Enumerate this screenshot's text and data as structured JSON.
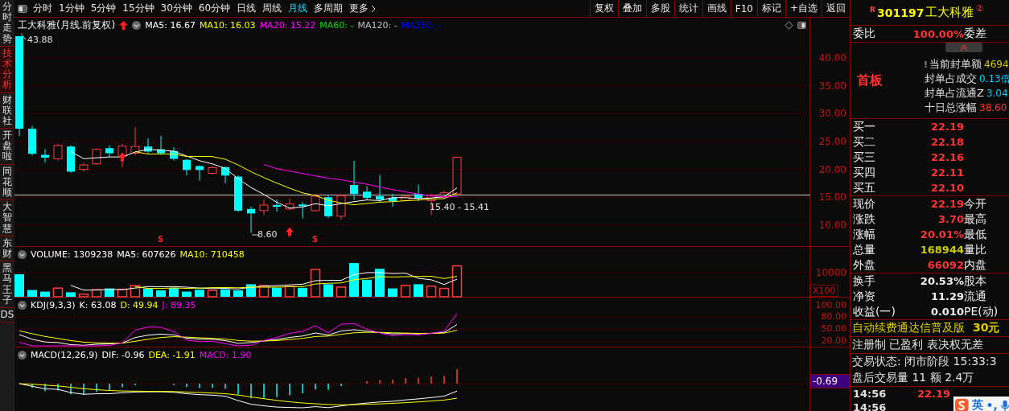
{
  "sidebar_tabs": [
    {
      "label": "分时走势",
      "selected": false
    },
    {
      "label": "技术分析",
      "selected": true
    },
    {
      "label": "财联社",
      "selected": false
    },
    {
      "label": "开盘啦",
      "selected": false
    },
    {
      "label": "同花顺",
      "selected": false
    },
    {
      "label": "大智慧",
      "selected": false
    },
    {
      "label": "东财",
      "selected": false
    },
    {
      "label": "黑马王子",
      "selected": false
    },
    {
      "label": "DS",
      "selected": false
    }
  ],
  "toolbar": {
    "periods": [
      {
        "label": "分时",
        "selected": false
      },
      {
        "label": "1分钟",
        "selected": false
      },
      {
        "label": "5分钟",
        "selected": false
      },
      {
        "label": "15分钟",
        "selected": false
      },
      {
        "label": "30分钟",
        "selected": false
      },
      {
        "label": "60分钟",
        "selected": false
      },
      {
        "label": "日线",
        "selected": false
      },
      {
        "label": "周线",
        "selected": false
      },
      {
        "label": "月线",
        "selected": true
      },
      {
        "label": "多周期",
        "selected": false
      }
    ],
    "more": "更多",
    "buttons": [
      "复权",
      "叠加",
      "多股",
      "统计",
      "画线",
      "F10",
      "标记",
      "+自选",
      "返回"
    ]
  },
  "chart": {
    "title": "工大科雅(月线.前复权)",
    "legend": [
      {
        "label": "MA5: 16.67",
        "color": "#ffffff"
      },
      {
        "label": "MA10: 16.03",
        "color": "#ffff00"
      },
      {
        "label": "MA20: 15.22",
        "color": "#ff00ff"
      },
      {
        "label": "MA60: -",
        "color": "#00e000"
      },
      {
        "label": "MA120: -",
        "color": "#c0c0c0"
      },
      {
        "label": "MA250: -",
        "color": "#0000ff"
      }
    ],
    "high_label": "43.88",
    "low_label": "8.60",
    "price_line_label": "15.40 - 15.41",
    "signals": [
      "S",
      "S"
    ],
    "axis": [
      "40.00",
      "35.00",
      "30.00",
      "25.00",
      "20.00",
      "15.00",
      "10.00"
    ]
  },
  "volume_pane": {
    "legend": [
      {
        "label": "VOLUME: 1309238",
        "color": "#ffffff"
      },
      {
        "label": "MA5: 607626",
        "color": "#ffffff"
      },
      {
        "label": "MA10: 710458",
        "color": "#ffff00"
      }
    ],
    "axis": [
      "10000"
    ],
    "unit": "X100"
  },
  "kdj_pane": {
    "legend": [
      {
        "label": "KDJ(9,3,3)",
        "color": "#ffffff"
      },
      {
        "label": "K: 63.08",
        "color": "#ffffff"
      },
      {
        "label": "D: 49.94",
        "color": "#ffff00"
      },
      {
        "label": "J: 89.35",
        "color": "#ff00ff"
      }
    ],
    "axis": [
      "100.00",
      "80.00",
      "50.00",
      "20.00"
    ]
  },
  "macd_pane": {
    "legend": [
      {
        "label": "MACD(12,26,9)",
        "color": "#ffffff"
      },
      {
        "label": "DIF: -0.96",
        "color": "#ffffff"
      },
      {
        "label": "DEA: -1.91",
        "color": "#ffff00"
      },
      {
        "label": "MACD: 1.90",
        "color": "#ff00ff"
      }
    ],
    "value_tag": "-0.69"
  },
  "quote": {
    "badge": "R",
    "code": "301197",
    "name": "工大科雅",
    "mark": "②",
    "ratio": {
      "label": "委比",
      "value": "100.00%",
      "label2": "委差"
    },
    "limit": {
      "tag": "首板",
      "lines": [
        {
          "label": "当前封单额",
          "value": "4694",
          "color": "#cccc00"
        },
        {
          "label": "封单占成交",
          "value": "0.13倍",
          "color": "#00ccff"
        },
        {
          "label": "封单占流通Z",
          "value": "3.04",
          "color": "#00ccff"
        },
        {
          "label": "十日总涨幅",
          "value": "38.60",
          "color": "#ff3333"
        }
      ]
    },
    "bids": [
      {
        "label": "买一",
        "price": "22.19"
      },
      {
        "label": "买二",
        "price": "22.18"
      },
      {
        "label": "买三",
        "price": "22.16"
      },
      {
        "label": "买四",
        "price": "22.11"
      },
      {
        "label": "买五",
        "price": "22.10"
      }
    ],
    "stats": [
      {
        "label": "现价",
        "value": "22.19",
        "color": "#ff3333",
        "label2": "今开"
      },
      {
        "label": "涨跌",
        "value": "3.70",
        "color": "#ff3333",
        "label2": "最高"
      },
      {
        "label": "涨幅",
        "value": "20.01%",
        "color": "#ff3333",
        "label2": "最低"
      },
      {
        "label": "总量",
        "value": "168944",
        "color": "#cccc00",
        "label2": "量比"
      },
      {
        "label": "外盘",
        "value": "66092",
        "color": "#ff3333",
        "label2": "内盘"
      }
    ],
    "fundamentals": [
      {
        "label": "换手",
        "value": "20.53%",
        "label2": "股本"
      },
      {
        "label": "净资",
        "value": "11.29",
        "label2": "流通"
      },
      {
        "label": "收益(一)",
        "value": "0.010",
        "label2": "PE(动)"
      }
    ],
    "promo": {
      "text": "自动续费通达信普及版",
      "price": "30元"
    },
    "tags": "注册制 已盈利 表决权无差",
    "status": "交易状态: 闭市阶段 15:33:3",
    "after_hours": "盘后交易量 11 额 2.4万",
    "ticks": [
      {
        "time": "14:56",
        "price": "22.19"
      },
      {
        "time": "14:56"
      }
    ]
  },
  "ime": {
    "mode": "英",
    "punctuation": "•,"
  }
}
